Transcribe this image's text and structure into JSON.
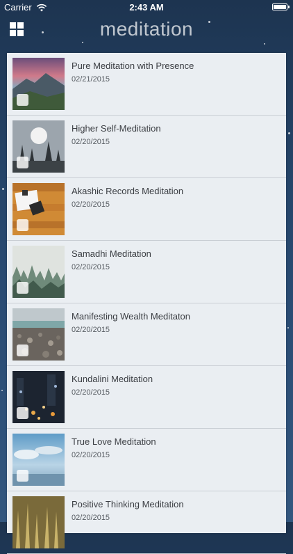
{
  "status_bar": {
    "carrier": "Carrier",
    "time": "2:43 AM",
    "battery_level": 1.0
  },
  "header": {
    "title": "meditation",
    "menu_icon": "grid-icon"
  },
  "items": [
    {
      "title": "Pure Meditation with Presence",
      "date": "02/21/2015",
      "thumbnail": "mountain-sunset",
      "has_media_icon": true
    },
    {
      "title": "Higher Self-Meditation",
      "date": "02/20/2015",
      "thumbnail": "misty-forest-sun",
      "has_media_icon": true
    },
    {
      "title": "Akashic Records Meditation",
      "date": "02/20/2015",
      "thumbnail": "open-book-wood",
      "has_media_icon": true
    },
    {
      "title": "Samadhi Meditation",
      "date": "02/20/2015",
      "thumbnail": "foggy-pine-trees",
      "has_media_icon": true
    },
    {
      "title": "Manifesting Wealth Meditaton",
      "date": "02/20/2015",
      "thumbnail": "pebble-beach",
      "has_media_icon": true
    },
    {
      "title": "Kundalini Meditation",
      "date": "02/20/2015",
      "thumbnail": "city-lights-night",
      "has_media_icon": true
    },
    {
      "title": "True Love Meditation",
      "date": "02/20/2015",
      "thumbnail": "cloudy-sea-sky",
      "has_media_icon": true
    },
    {
      "title": "Positive Thinking Meditation",
      "date": "02/20/2015",
      "thumbnail": "sunlit-grass",
      "has_media_icon": false
    }
  ],
  "colors": {
    "background": "#25456a",
    "list_background": "#eaeef2",
    "title_text": "#3a3d42",
    "date_text": "#555a60"
  }
}
